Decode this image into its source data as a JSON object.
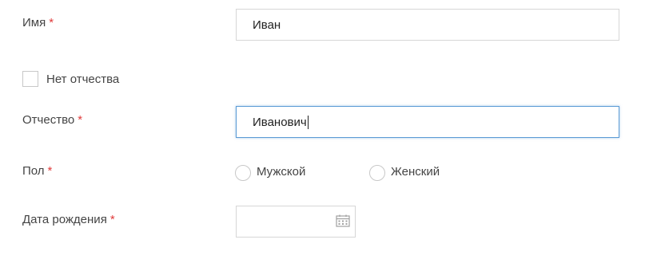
{
  "form": {
    "first_name": {
      "label": "Имя",
      "required_mark": "*",
      "value": "Иван"
    },
    "no_patronymic": {
      "label": "Нет отчества",
      "checked": false
    },
    "patronymic": {
      "label": "Отчество",
      "required_mark": "*",
      "value": "Иванович"
    },
    "gender": {
      "label": "Пол",
      "required_mark": "*",
      "options": [
        {
          "label": "Мужской",
          "selected": false
        },
        {
          "label": "Женский",
          "selected": false
        }
      ]
    },
    "birth_date": {
      "label": "Дата рождения",
      "required_mark": "*",
      "value": "",
      "icon": "calendar-icon"
    }
  },
  "colors": {
    "required": "#e03a3a",
    "focus_border": "#5b9bd5",
    "border": "#d6d6d6"
  }
}
